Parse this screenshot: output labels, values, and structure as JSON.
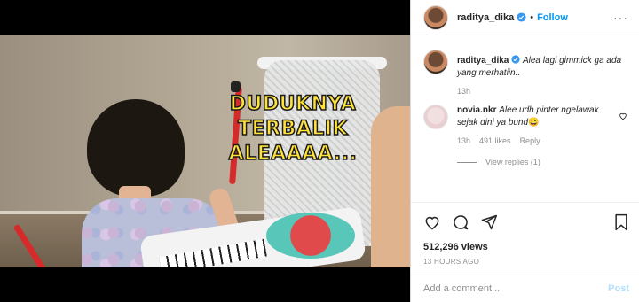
{
  "post": {
    "username": "raditya_dika",
    "follow_label": "Follow",
    "more_icon": "ellipsis-icon"
  },
  "media": {
    "caption_line1": "DUDUKNYA TERBALIK",
    "caption_line2": "ALEAAAA..."
  },
  "caption": {
    "username": "raditya_dika",
    "text": "Alea lagi gimmick ga ada yang merhatiin..",
    "time": "13h"
  },
  "comment": {
    "username": "novia.nkr",
    "text": "Alee udh pinter ngelawak sejak dini ya bund",
    "emoji": "😀",
    "time": "13h",
    "likes": "491 likes",
    "reply_label": "Reply",
    "view_replies": "View replies (1)"
  },
  "stats": {
    "views": "512,296 views",
    "timestamp": "13 HOURS AGO"
  },
  "add_comment": {
    "placeholder": "Add a comment...",
    "post_label": "Post"
  },
  "colors": {
    "link_blue": "#0095f6",
    "post_disabled": "#b2dffc",
    "caption_yellow": "#ffe23a"
  }
}
